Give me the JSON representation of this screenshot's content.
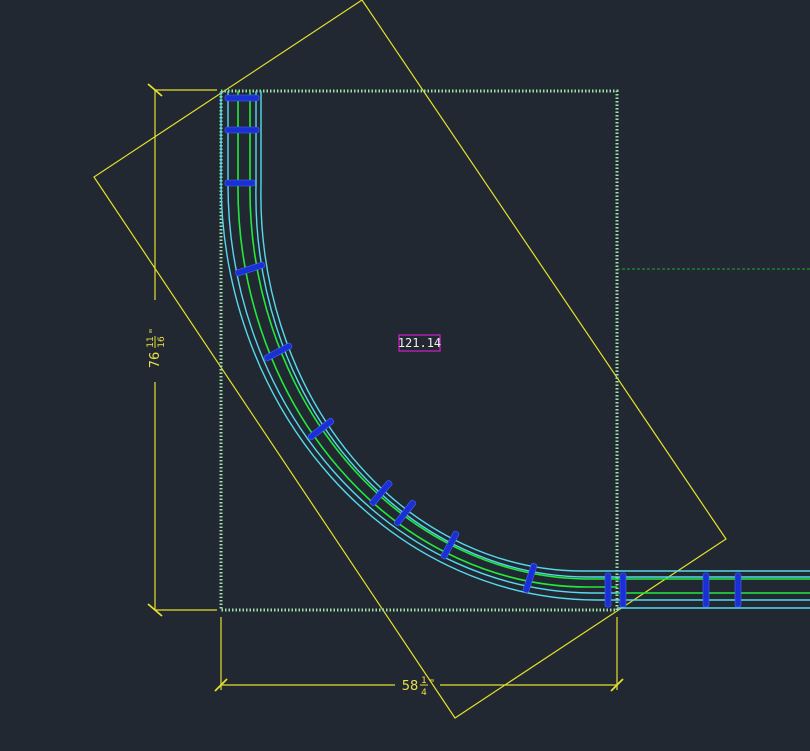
{
  "drawing": {
    "background_color": "#222831",
    "colors": {
      "dimension": "#e6df2e",
      "outline_dotted": "#9fe0a8",
      "track_rail_cyan": "#56d9ec",
      "track_center_green": "#22e83c",
      "tie_blue": "#1a2fd6",
      "tag_border": "#d020c8",
      "extension_line": "#1faa2a"
    },
    "tag": {
      "text": "121.14"
    },
    "dimensions": {
      "height": {
        "whole": "76",
        "num": "11",
        "den": "16",
        "unit": "\""
      },
      "width": {
        "whole": "58",
        "num": "1",
        "den": "4",
        "unit": "\""
      }
    }
  }
}
